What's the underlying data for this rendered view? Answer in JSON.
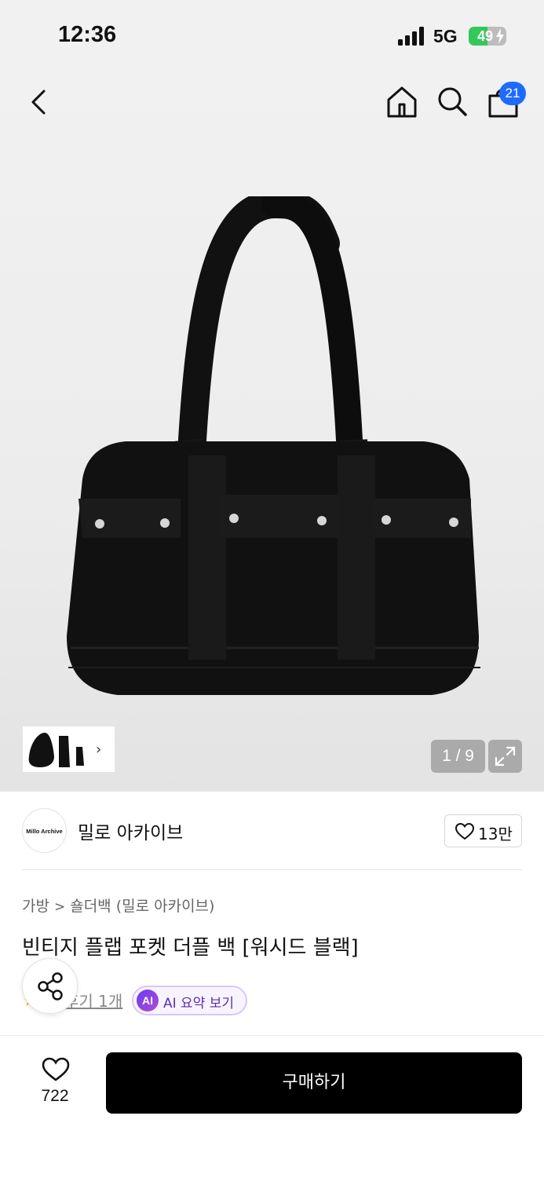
{
  "status_bar": {
    "time": "12:36",
    "network": "5G",
    "battery_level": "49",
    "battery_fraction": 0.49,
    "battery_color": "#34c759"
  },
  "nav": {
    "back_icon": "chevron-left-icon",
    "home_icon": "home-icon",
    "search_icon": "search-icon",
    "cart_icon": "shopping-bag-icon",
    "cart_count": "21",
    "badge_color": "#1e6bff"
  },
  "gallery": {
    "counter": "1 / 9",
    "thumbnail_arrow": "›",
    "fullscreen_icon": "expand-icon"
  },
  "brand": {
    "logo_text": "Millo Archive",
    "name": "밀로 아카이브",
    "like_count": "13만"
  },
  "product": {
    "breadcrumb": [
      "가방",
      "숄더백 (밀로 아카이브)"
    ],
    "title": "빈티지 플랩 포켓 더플 백 [워시드 블랙]",
    "review_link": "후기 1개",
    "ai_badge": "AI",
    "ai_summary": "AI 요약 보기"
  },
  "bottom_bar": {
    "wish_count": "722",
    "buy_label": "구매하기"
  }
}
